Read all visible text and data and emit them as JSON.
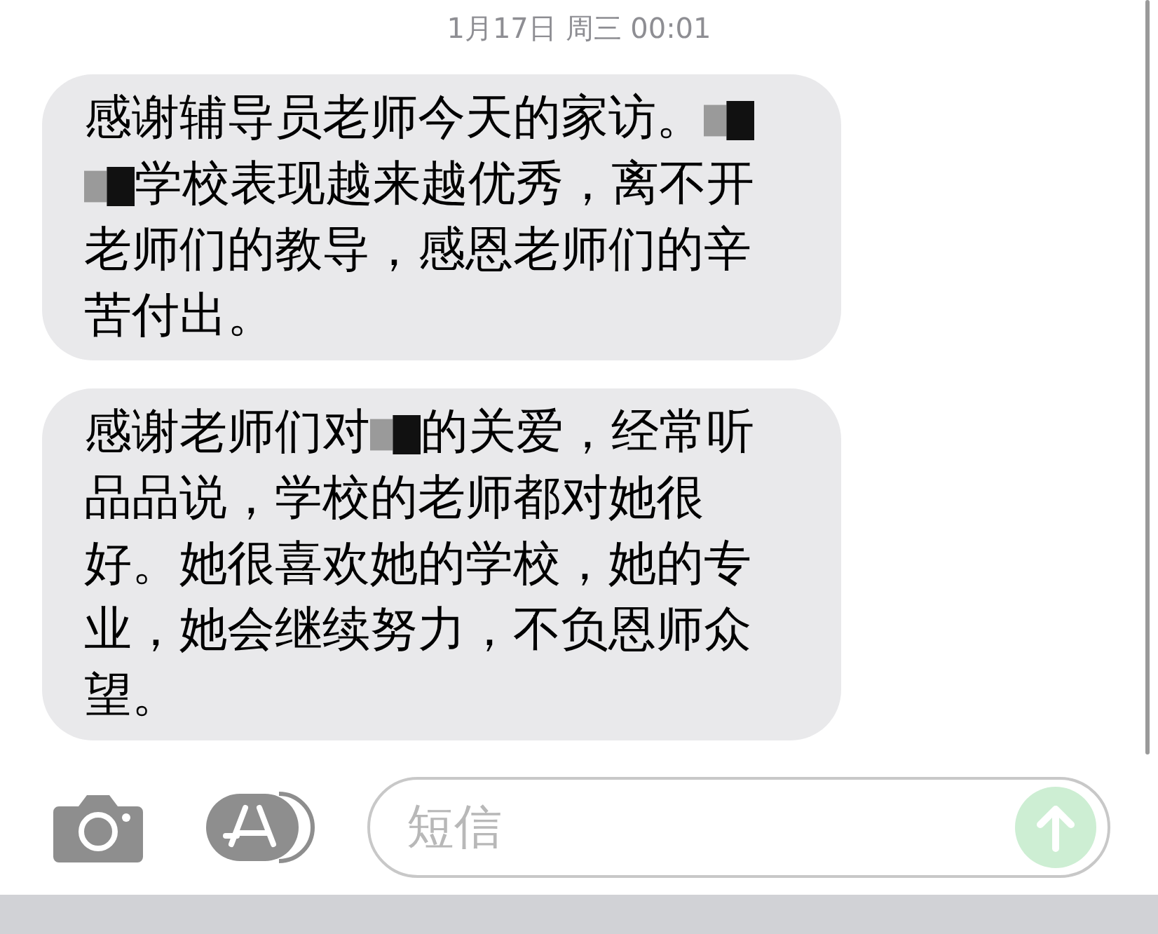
{
  "timestamp": "1月17日 周三 00:01",
  "messages": [
    {
      "parts": [
        {
          "kind": "text",
          "text": "感谢辅导员老师今天的家访。"
        },
        {
          "kind": "redaction"
        },
        {
          "kind": "redaction"
        },
        {
          "kind": "text",
          "text": "学校表现越来越优秀，离不开老师们的教导，感恩老师们的辛苦付出。"
        }
      ]
    },
    {
      "parts": [
        {
          "kind": "text",
          "text": "感谢老师们对"
        },
        {
          "kind": "redaction"
        },
        {
          "kind": "text",
          "text": "的关爱，经常听品品说，学校的老师都对她很好。她很喜欢她的学校，她的专业，她会继续努力，不负恩师众望。"
        }
      ]
    }
  ],
  "composer": {
    "placeholder": "短信"
  }
}
